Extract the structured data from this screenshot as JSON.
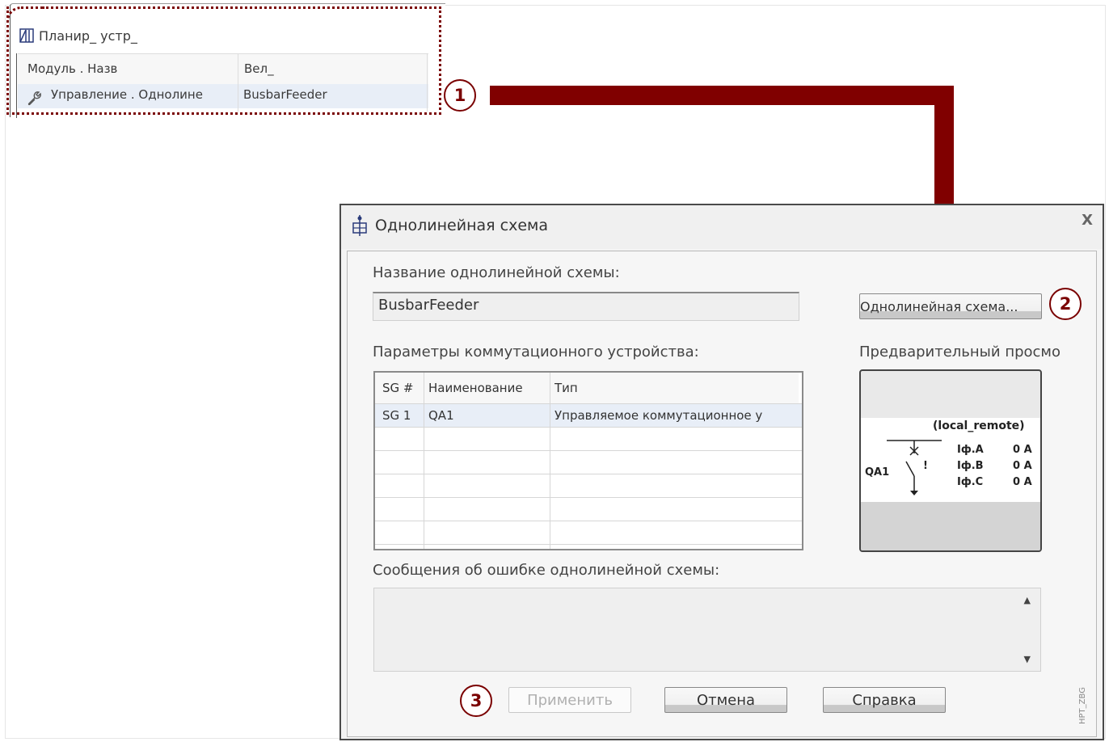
{
  "planning": {
    "title": "Планир_ устр_",
    "columns": [
      "Модуль . Назв",
      "Вел_"
    ],
    "row": {
      "module": "Управление . Однолине",
      "value": "BusbarFeeder"
    }
  },
  "callouts": [
    "1",
    "2",
    "3"
  ],
  "dialog": {
    "title": "Однолинейная схема",
    "close_label": "X",
    "sld_name_label": "Название однолинейной схемы:",
    "sld_name_value": "BusbarFeeder",
    "sld_button": "Однолинейная схема...",
    "switchgear_label": "Параметры коммутационного устройства:",
    "preview_label": "Предварительный просмо",
    "table": {
      "columns": [
        "SG #",
        "Наименование",
        "Тип"
      ],
      "rows": [
        {
          "sg": "SG 1",
          "name": "QA1",
          "type": "Управляемое коммутационное у"
        }
      ]
    },
    "preview": {
      "header": "(local_remote)",
      "device": "QA1",
      "warn": "!",
      "readings": [
        {
          "label": "Iф.A",
          "value": "0 A"
        },
        {
          "label": "Iф.B",
          "value": "0 A"
        },
        {
          "label": "Iф.C",
          "value": "0 A"
        }
      ]
    },
    "errors_label": "Сообщения об ошибке однолинейной схемы:",
    "buttons": {
      "apply": "Применить",
      "cancel": "Отмена",
      "help": "Справка"
    }
  },
  "watermark": "HPT_ZBG",
  "colors": {
    "callout": "#7a0000",
    "arrow": "#800000",
    "selection": "#e8eef7"
  }
}
